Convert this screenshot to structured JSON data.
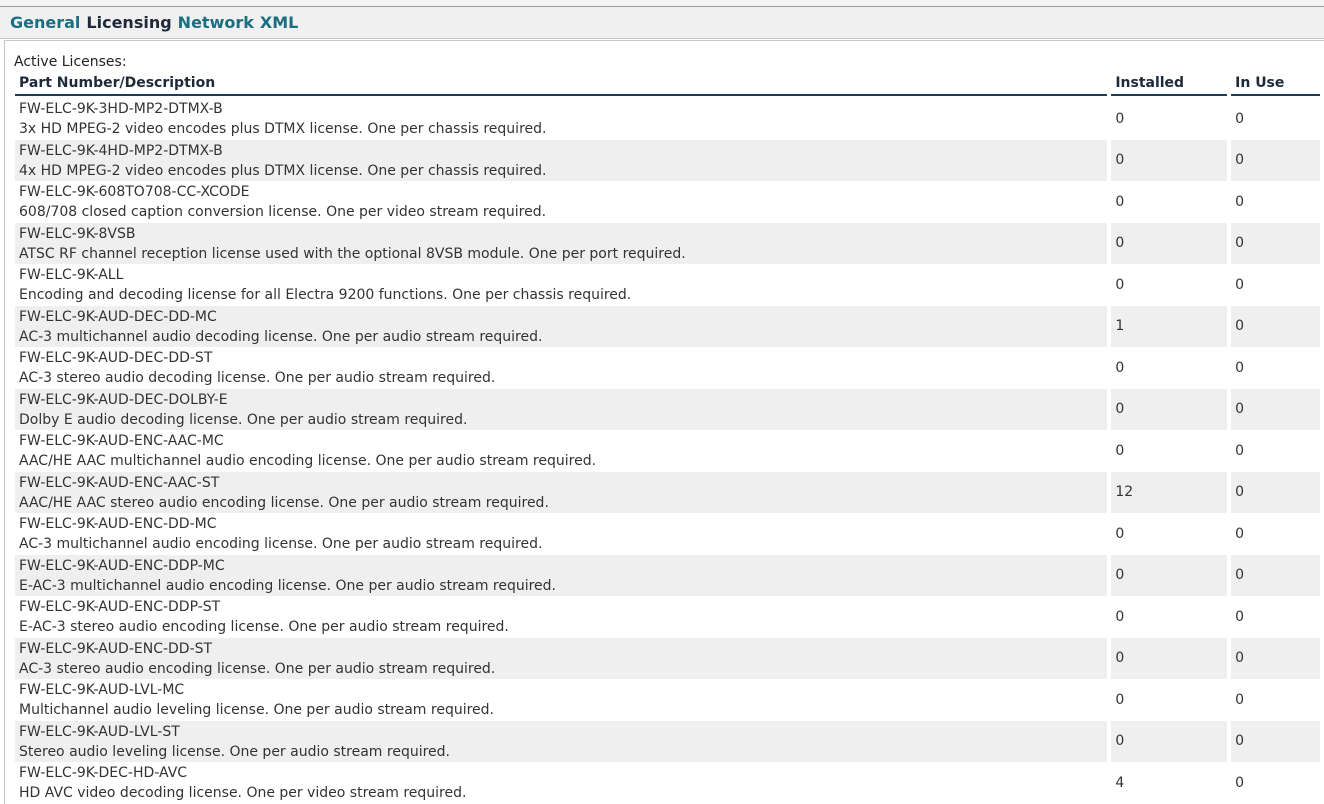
{
  "tabs": [
    {
      "label": "General",
      "active": false
    },
    {
      "label": "Licensing",
      "active": true
    },
    {
      "label": "Network",
      "active": false
    },
    {
      "label": "XML",
      "active": false
    }
  ],
  "section_label": "Active Licenses:",
  "table": {
    "headers": {
      "part": "Part Number/Description",
      "installed": "Installed",
      "in_use": "In Use"
    },
    "rows": [
      {
        "part": "FW-ELC-9K-3HD-MP2-DTMX-B",
        "desc": "3x HD MPEG-2 video encodes plus DTMX license. One per chassis required.",
        "installed": "0",
        "in_use": "0"
      },
      {
        "part": "FW-ELC-9K-4HD-MP2-DTMX-B",
        "desc": "4x HD MPEG-2 video encodes plus DTMX license. One per chassis required.",
        "installed": "0",
        "in_use": "0"
      },
      {
        "part": "FW-ELC-9K-608TO708-CC-XCODE",
        "desc": "608/708 closed caption conversion license. One per video stream required.",
        "installed": "0",
        "in_use": "0"
      },
      {
        "part": "FW-ELC-9K-8VSB",
        "desc": "ATSC RF channel reception license used with the optional 8VSB module. One per port required.",
        "installed": "0",
        "in_use": "0"
      },
      {
        "part": "FW-ELC-9K-ALL",
        "desc": "Encoding and decoding license for all Electra 9200 functions. One per chassis required.",
        "installed": "0",
        "in_use": "0"
      },
      {
        "part": "FW-ELC-9K-AUD-DEC-DD-MC",
        "desc": "AC-3 multichannel audio decoding license. One per audio stream required.",
        "installed": "1",
        "in_use": "0"
      },
      {
        "part": "FW-ELC-9K-AUD-DEC-DD-ST",
        "desc": "AC-3 stereo audio decoding license. One per audio stream required.",
        "installed": "0",
        "in_use": "0"
      },
      {
        "part": "FW-ELC-9K-AUD-DEC-DOLBY-E",
        "desc": "Dolby E audio decoding license. One per audio stream required.",
        "installed": "0",
        "in_use": "0"
      },
      {
        "part": "FW-ELC-9K-AUD-ENC-AAC-MC",
        "desc": "AAC/HE AAC multichannel audio encoding license. One per audio stream required.",
        "installed": "0",
        "in_use": "0"
      },
      {
        "part": "FW-ELC-9K-AUD-ENC-AAC-ST",
        "desc": "AAC/HE AAC stereo audio encoding license. One per audio stream required.",
        "installed": "12",
        "in_use": "0"
      },
      {
        "part": "FW-ELC-9K-AUD-ENC-DD-MC",
        "desc": "AC-3 multichannel audio encoding license. One per audio stream required.",
        "installed": "0",
        "in_use": "0"
      },
      {
        "part": "FW-ELC-9K-AUD-ENC-DDP-MC",
        "desc": "E-AC-3 multichannel audio encoding license. One per audio stream required.",
        "installed": "0",
        "in_use": "0"
      },
      {
        "part": "FW-ELC-9K-AUD-ENC-DDP-ST",
        "desc": "E-AC-3 stereo audio encoding license. One per audio stream required.",
        "installed": "0",
        "in_use": "0"
      },
      {
        "part": "FW-ELC-9K-AUD-ENC-DD-ST",
        "desc": "AC-3 stereo audio encoding license. One per audio stream required.",
        "installed": "0",
        "in_use": "0"
      },
      {
        "part": "FW-ELC-9K-AUD-LVL-MC",
        "desc": "Multichannel audio leveling license. One per audio stream required.",
        "installed": "0",
        "in_use": "0"
      },
      {
        "part": "FW-ELC-9K-AUD-LVL-ST",
        "desc": "Stereo audio leveling license. One per audio stream required.",
        "installed": "0",
        "in_use": "0"
      },
      {
        "part": "FW-ELC-9K-DEC-HD-AVC",
        "desc": "HD AVC video decoding license. One per video stream required.",
        "installed": "4",
        "in_use": "0"
      }
    ]
  }
}
